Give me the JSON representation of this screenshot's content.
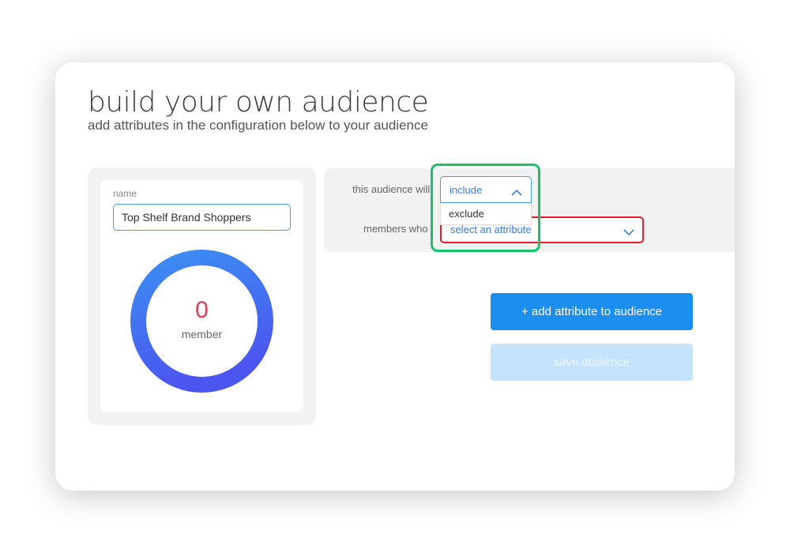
{
  "header": {
    "title": "build your own audience",
    "subtitle": "add attributes in the configuration below to your audience"
  },
  "audience_card": {
    "name_label": "name",
    "name_value": "Top Shelf Brand Shoppers",
    "member_count": "0",
    "member_label": "member",
    "gauge_colors": {
      "start": "#3b8ef2",
      "end": "#4b56f0"
    }
  },
  "configuration": {
    "row1_label": "this audience will",
    "row2_label": "members who",
    "mode_select": {
      "value": "include",
      "expanded": true,
      "options": [
        "exclude"
      ]
    },
    "attribute_select": {
      "placeholder": "select an attribute"
    }
  },
  "actions": {
    "add_attribute_label": "+ add attribute to audience",
    "save_label": "save audience",
    "save_enabled": false
  },
  "colors": {
    "primary": "#1c8ef0",
    "primary_disabled": "#c5e3fa",
    "count": "#e23b5a",
    "highlight_green": "#1fbf6a",
    "highlight_red": "#e0202e"
  },
  "icons": {
    "include_select": "chevron-up-icon",
    "attribute_select": "chevron-down-icon"
  }
}
